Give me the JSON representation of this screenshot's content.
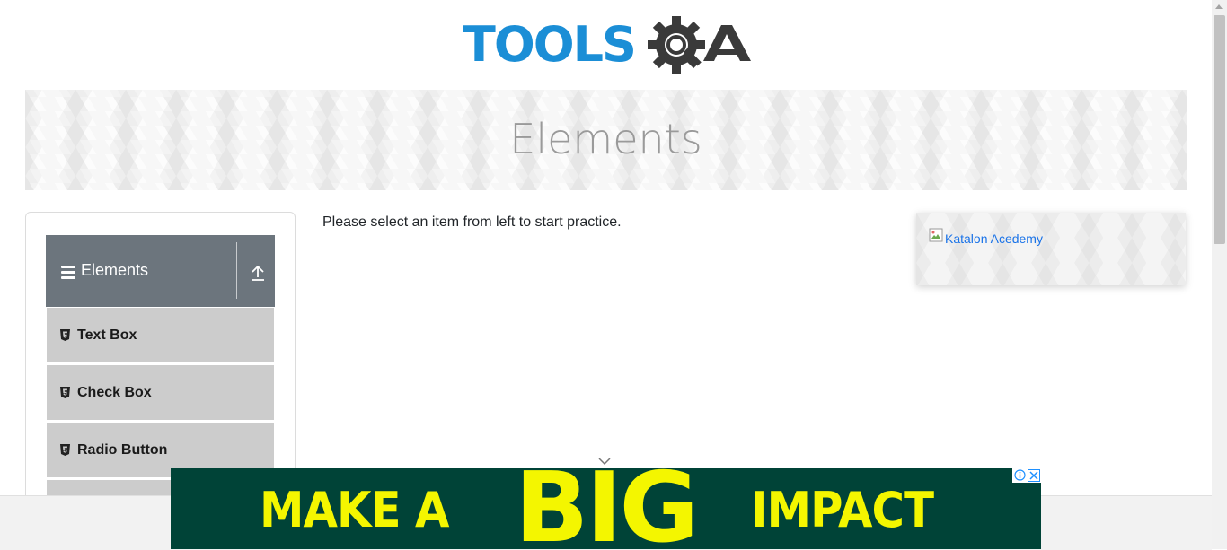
{
  "header": {
    "logo_text_left": "TOOLS",
    "logo_text_right": "QA",
    "logo_color_primary": "#1b8ed6",
    "logo_color_secondary": "#3a3a3a"
  },
  "banner": {
    "title": "Elements"
  },
  "sidebar": {
    "group_label": "Elements",
    "group_icon": "hamburger-icon",
    "collapse_icon": "upload-arrow-icon",
    "items": [
      {
        "label": "Text Box",
        "icon": "html5-icon"
      },
      {
        "label": "Check Box",
        "icon": "html5-icon"
      },
      {
        "label": "Radio Button",
        "icon": "html5-icon"
      }
    ]
  },
  "main": {
    "instruction": "Please select an item from left to start practice."
  },
  "side_ad": {
    "alt_text": "Katalon Acedemy",
    "link_color": "#1a73e8"
  },
  "bottom_ad": {
    "word1": "MAKE A",
    "word2": "BIG",
    "word3": "IMPACT",
    "background": "#004337",
    "text_color": "#f4f600"
  }
}
